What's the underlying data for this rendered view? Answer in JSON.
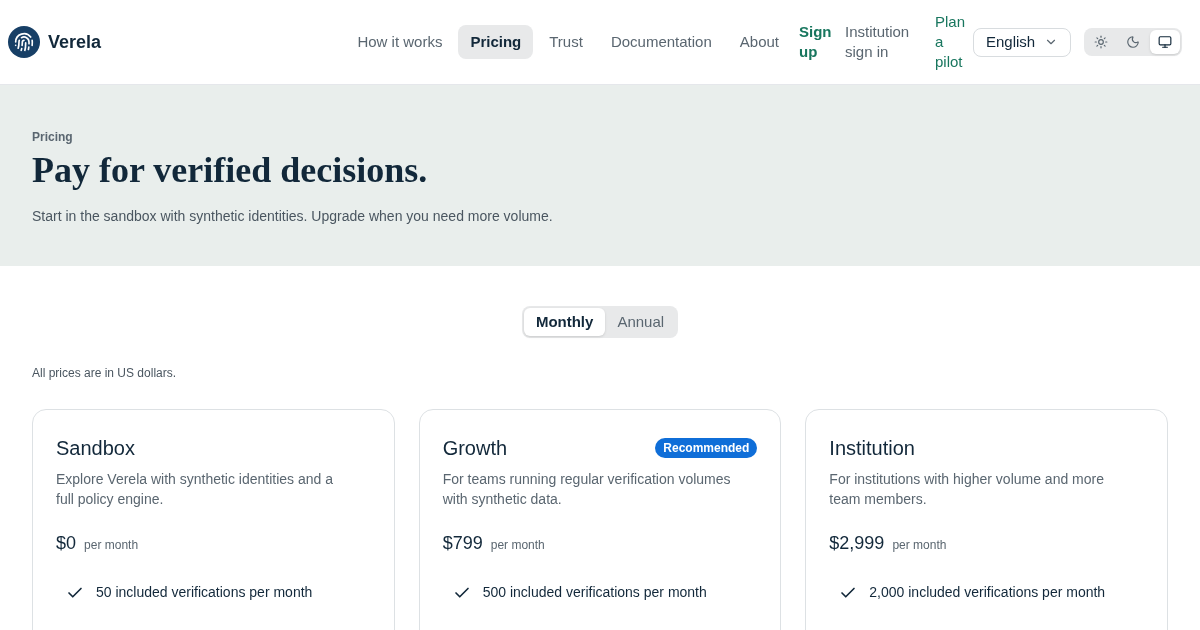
{
  "brand": {
    "name": "Verela"
  },
  "nav": [
    {
      "label": "How it works",
      "selected": false
    },
    {
      "label": "Pricing",
      "selected": true
    },
    {
      "label": "Trust",
      "selected": false
    },
    {
      "label": "Documentation",
      "selected": false
    },
    {
      "label": "About",
      "selected": false
    }
  ],
  "actions": [
    {
      "label": "Sign up",
      "kind": "primary"
    },
    {
      "label": "Institution sign in",
      "kind": "secondary"
    },
    {
      "label": "Plan a pilot",
      "kind": "accent"
    }
  ],
  "language": {
    "value": "English"
  },
  "theme_toggle": [
    {
      "kind": "light",
      "selected": false
    },
    {
      "kind": "dark",
      "selected": false
    },
    {
      "kind": "system",
      "selected": true
    }
  ],
  "hero": {
    "eyebrow": "Pricing",
    "title": "Pay for verified decisions.",
    "subtitle": "Start in the sandbox with synthetic identities. Upgrade when you need more volume."
  },
  "billing": [
    {
      "label": "Monthly",
      "selected": true
    },
    {
      "label": "Annual",
      "selected": false
    }
  ],
  "currency_note": "All prices are in US dollars.",
  "plans": [
    {
      "name": "Sandbox",
      "description": "Explore Verela with synthetic identities and a full policy engine.",
      "price": "$0",
      "period": "per month",
      "features": [
        "50 included verifications per month"
      ]
    },
    {
      "name": "Growth",
      "badge": "Recommended",
      "description": "For teams running regular verification volumes with synthetic data.",
      "price": "$799",
      "period": "per month",
      "features": [
        "500 included verifications per month"
      ]
    },
    {
      "name": "Institution",
      "description": "For institutions with higher volume and more team members.",
      "price": "$2,999",
      "period": "per month",
      "features": [
        "2,000 included verifications per month"
      ]
    }
  ]
}
